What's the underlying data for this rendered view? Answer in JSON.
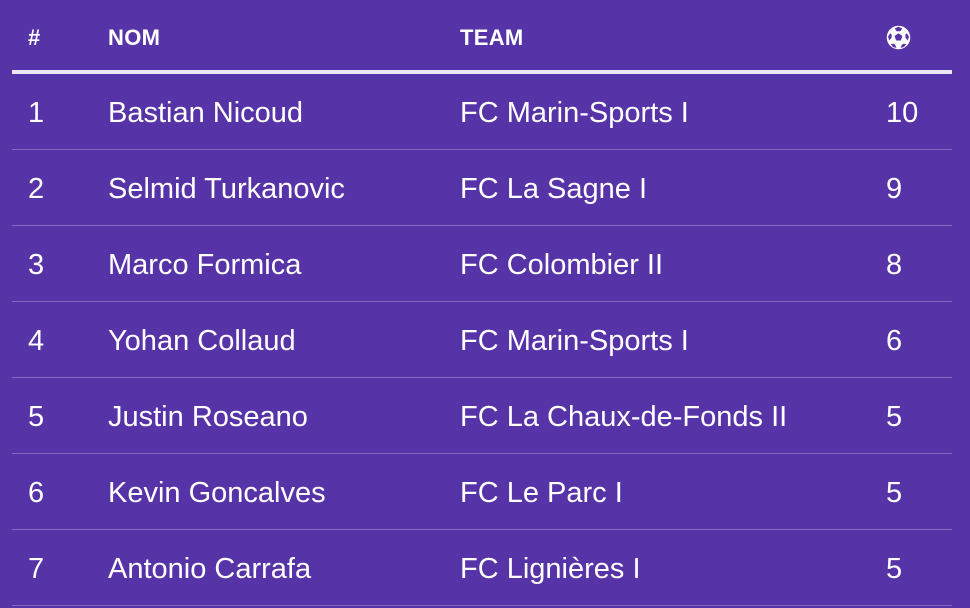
{
  "table": {
    "headers": {
      "rank": "#",
      "name": "NOM",
      "team": "TEAM",
      "goals_icon": "soccer-ball-icon"
    },
    "rows": [
      {
        "rank": "1",
        "name": "Bastian Nicoud",
        "team": "FC Marin-Sports I",
        "goals": "10"
      },
      {
        "rank": "2",
        "name": "Selmid Turkanovic",
        "team": "FC La Sagne I",
        "goals": "9"
      },
      {
        "rank": "3",
        "name": "Marco Formica",
        "team": "FC Colombier II",
        "goals": "8"
      },
      {
        "rank": "4",
        "name": "Yohan Collaud",
        "team": "FC Marin-Sports I",
        "goals": "6"
      },
      {
        "rank": "5",
        "name": "Justin Roseano",
        "team": "FC La Chaux-de-Fonds II",
        "goals": "5"
      },
      {
        "rank": "6",
        "name": "Kevin Goncalves",
        "team": "FC Le Parc I",
        "goals": "5"
      },
      {
        "rank": "7",
        "name": "Antonio Carrafa",
        "team": "FC Lignières I",
        "goals": "5"
      }
    ]
  },
  "colors": {
    "background": "#5733a8",
    "text": "#ffffff"
  }
}
